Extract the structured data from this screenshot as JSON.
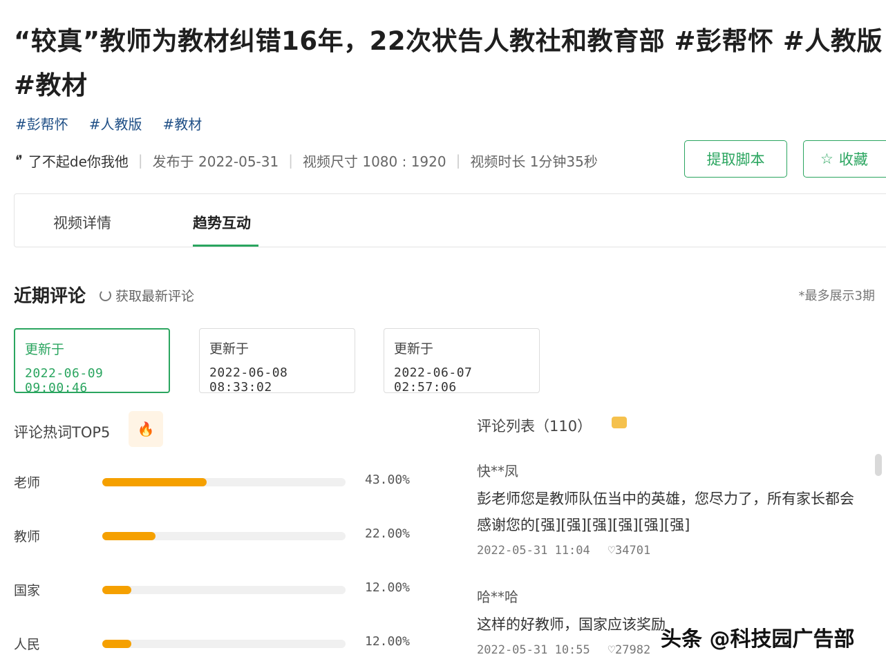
{
  "video": {
    "title": "“较真”教师为教材纠错16年，22次状告人教社和教育部 #彭帮怀 #人教版 #教材",
    "tags": [
      "#彭帮怀",
      "#人教版",
      "#教材"
    ],
    "author_icon": "❛❜",
    "author": "了不起de你我他",
    "published": "发布于 2022-05-31",
    "size": "视频尺寸 1080 : 1920",
    "duration": "视频时长 1分钟35秒"
  },
  "buttons": {
    "extract_script": "提取脚本",
    "favorite": "收藏"
  },
  "tabs": {
    "details": "视频详情",
    "trend": "趋势互动"
  },
  "recent": {
    "title": "近期评论",
    "refresh_label": "获取最新评论",
    "note": "*最多展示3期",
    "dates": [
      {
        "label": "更新于",
        "datetime": "2022-06-09 09:00:46"
      },
      {
        "label": "更新于",
        "datetime": "2022-06-08 08:33:02"
      },
      {
        "label": "更新于",
        "datetime": "2022-06-07 02:57:06"
      }
    ]
  },
  "keywords": {
    "title": "评论热词TOP5",
    "items": [
      {
        "word": "老师",
        "percent": "43.00%",
        "value": 43
      },
      {
        "word": "教师",
        "percent": "22.00%",
        "value": 22
      },
      {
        "word": "国家",
        "percent": "12.00%",
        "value": 12
      },
      {
        "word": "人民",
        "percent": "12.00%",
        "value": 12
      }
    ]
  },
  "comments": {
    "title": "评论列表（110）",
    "items": [
      {
        "user": "快**凤",
        "text": "彭老师您是教师队伍当中的英雄，您尽力了，所有家长都会感谢您的[强][强][强][强][强][强]",
        "time": "2022-05-31 11:04",
        "likes": "♡34701"
      },
      {
        "user": "哈**哈",
        "text": "这样的好教师，国家应该奖励",
        "time": "2022-05-31 10:55",
        "likes": "♡27982"
      }
    ]
  },
  "watermark": "头条 @科技园广告部"
}
